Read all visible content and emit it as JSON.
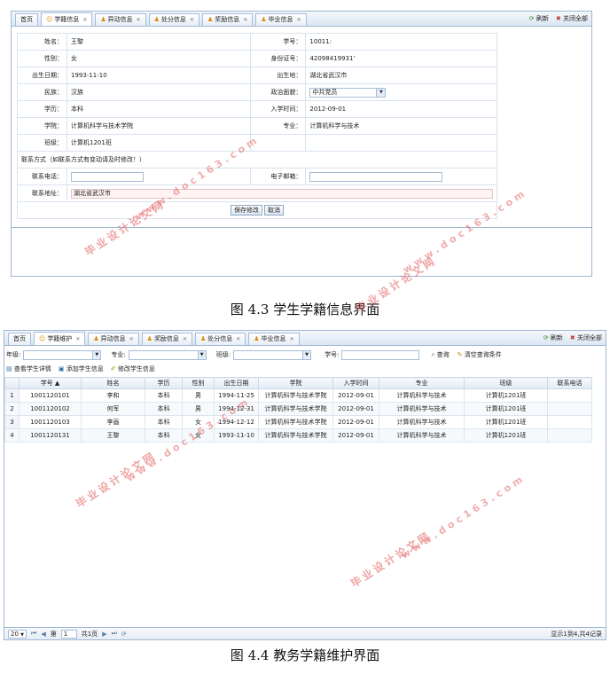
{
  "tabs_top": [
    "首页",
    "学籍信息",
    "异动信息",
    "处分信息",
    "奖励信息",
    "毕业信息"
  ],
  "tabs_bottom": [
    "首页",
    "学籍维护",
    "异动信息",
    "奖励信息",
    "处分信息",
    "毕业信息"
  ],
  "tool_refresh": "刷新",
  "tool_close_all": "关闭全部",
  "form": {
    "name_label": "姓名：",
    "name_value": "王黎",
    "stuno_label": "学号：",
    "stuno_value": "10011:",
    "gender_label": "性别：",
    "gender_value": "女",
    "idcard_label": "身份证号：",
    "idcard_value": "42098419931'",
    "birth_label": "出生日期：",
    "birth_value": "1993-11-10",
    "birthplace_label": "出生地：",
    "birthplace_value": "湖北省武汉市",
    "ethnic_label": "民族：",
    "ethnic_value": "汉族",
    "political_label": "政治面貌：",
    "political_value": "中共党员",
    "edu_label": "学历：",
    "edu_value": "本科",
    "enroll_label": "入学时间：",
    "enroll_value": "2012-09-01",
    "college_label": "学院：",
    "college_value": "计算机科学与技术学院",
    "major_label": "专业：",
    "major_value": "计算机科学与技术",
    "class_label": "班级：",
    "class_value": "计算机1201班",
    "contact_note": "联系方式（如联系方式有变动请及时修改！）",
    "phone_label": "联系电话：",
    "email_label": "电子邮箱：",
    "address_label": "联系地址：",
    "address_value": "湖北省武汉市",
    "save_btn": "保存修改",
    "cancel_btn": "取消"
  },
  "caption1": "图 4.3  学生学籍信息界面",
  "filter": {
    "grade_label": "年级:",
    "major_label": "专业:",
    "class_label": "班级:",
    "stuno_label": "学号:",
    "search_btn": "查询",
    "clear_btn": "清空查询条件"
  },
  "toolbar": [
    "查看学生详情",
    "添加学生信息",
    "修改学生信息"
  ],
  "grid": {
    "columns": [
      "学号 ▲",
      "姓名",
      "学历",
      "性别",
      "出生日期",
      "学院",
      "入学时间",
      "专业",
      "班级",
      "联系电话"
    ],
    "rows": [
      [
        "1",
        "1001120101",
        "李和",
        "本科",
        "男",
        "1994-11-25",
        "计算机科学与技术学院",
        "2012-09-01",
        "计算机科学与技术",
        "计算机1201班",
        ""
      ],
      [
        "2",
        "1001120102",
        "何军",
        "本科",
        "男",
        "1994-12-31",
        "计算机科学与技术学院",
        "2012-09-01",
        "计算机科学与技术",
        "计算机1201班",
        ""
      ],
      [
        "3",
        "1001120103",
        "李画",
        "本科",
        "女",
        "1994-12-12",
        "计算机科学与技术学院",
        "2012-09-01",
        "计算机科学与技术",
        "计算机1201班",
        ""
      ],
      [
        "4",
        "1001120131",
        "王黎",
        "本科",
        "女",
        "1993-11-10",
        "计算机科学与技术学院",
        "2012-09-01",
        "计算机科学与技术",
        "计算机1201班",
        ""
      ]
    ]
  },
  "pager": {
    "page_size": "20",
    "page_prefix": "第",
    "page_num": "1",
    "page_total": "共1页",
    "info": "显示1到4,共4记录"
  },
  "caption2": "图 4.4  教务学籍维护界面",
  "watermark": {
    "cn": "毕业设计论文网",
    "url": "www.doc163.com"
  },
  "colors": {
    "border": "#9fb6d3",
    "watermark": "#e15a5a"
  }
}
